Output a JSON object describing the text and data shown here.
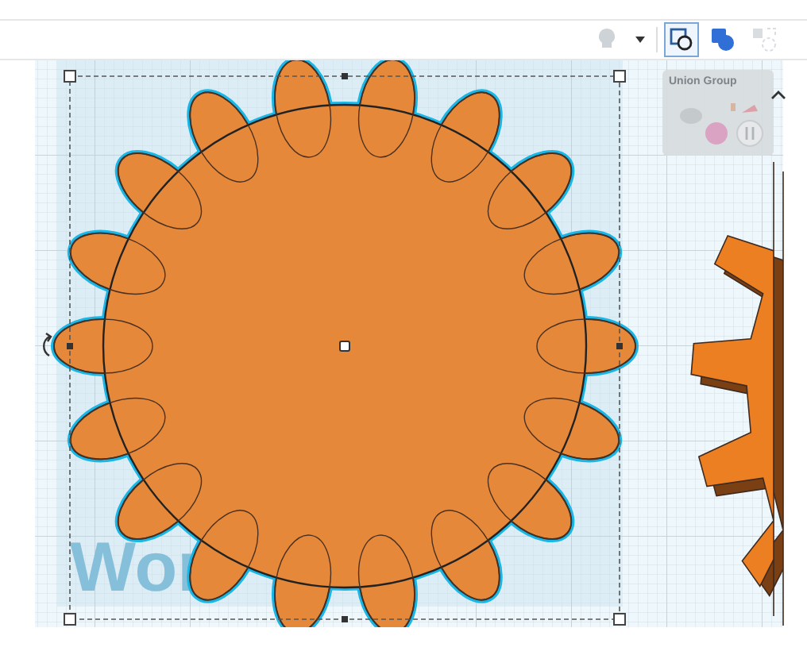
{
  "toolbar": {
    "buttons": [
      {
        "kind": "bulb",
        "disabled": true
      },
      {
        "kind": "caret",
        "disabled": false
      },
      {
        "kind": "group",
        "selected": true
      },
      {
        "kind": "union",
        "selected": false
      },
      {
        "kind": "align",
        "disabled": true
      }
    ]
  },
  "inspector": {
    "title": "Union Group",
    "expanded": true
  },
  "workplane": {
    "label": "Wor"
  },
  "canvas": {
    "objects": [
      {
        "kind": "flower",
        "selected": true
      },
      {
        "kind": "gear",
        "selected": false
      }
    ]
  }
}
